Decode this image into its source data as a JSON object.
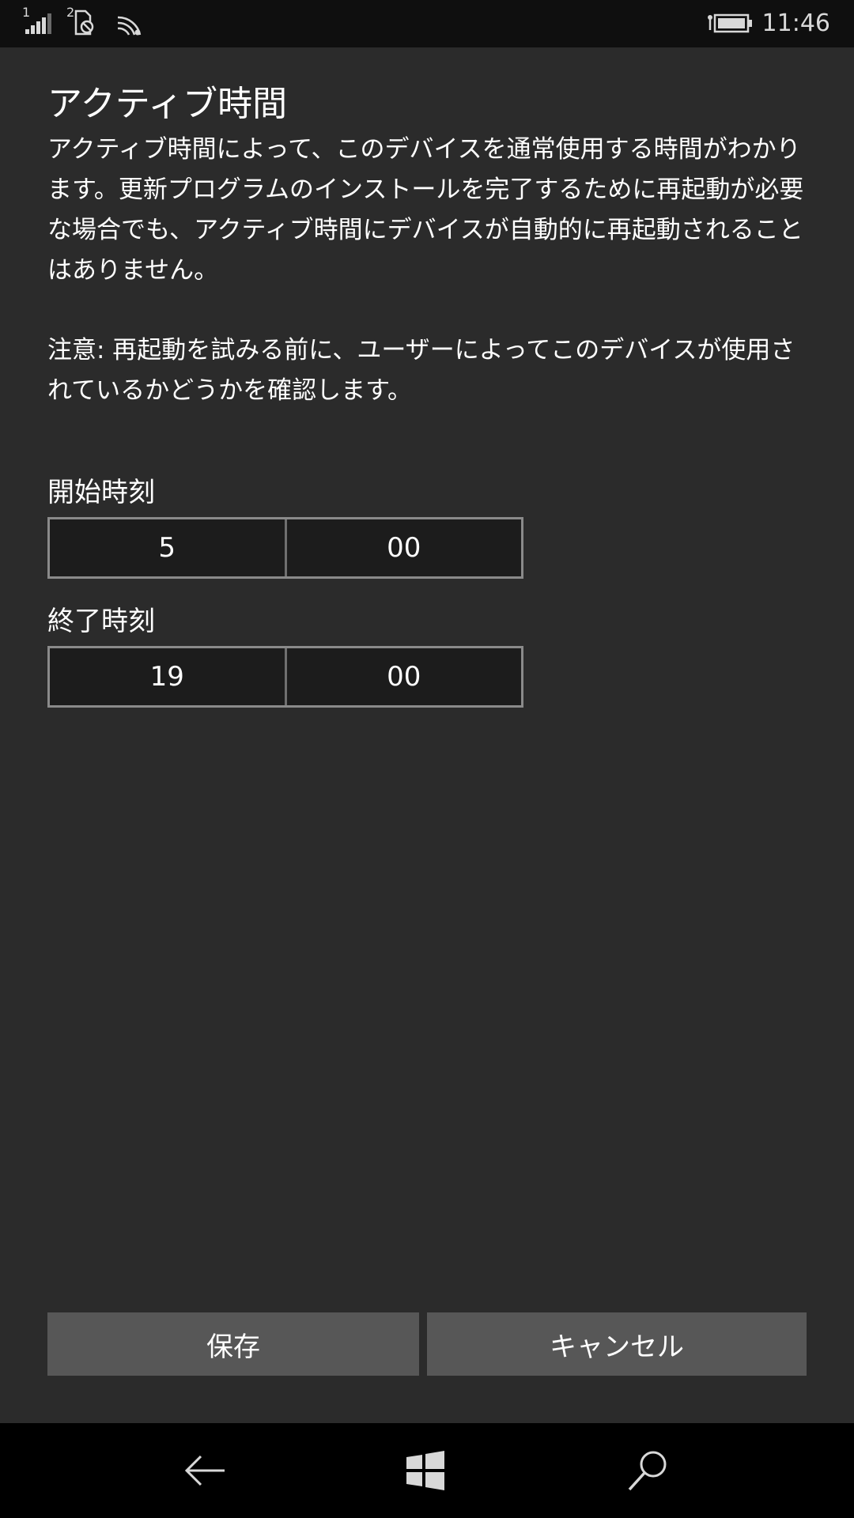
{
  "status_bar": {
    "sim1_label": "1",
    "sim2_label": "2",
    "time": "11:46"
  },
  "page": {
    "title": "アクティブ時間",
    "description": "アクティブ時間によって、このデバイスを通常使用する時間がわかります。更新プログラムのインストールを完了するために再起動が必要な場合でも、アクティブ時間にデバイスが自動的に再起動されることはありません。",
    "note": "注意: 再起動を試みる前に、ユーザーによってこのデバイスが使用されているかどうかを確認します。"
  },
  "start_time": {
    "label": "開始時刻",
    "hour": "5",
    "minute": "00"
  },
  "end_time": {
    "label": "終了時刻",
    "hour": "19",
    "minute": "00"
  },
  "buttons": {
    "save_label": "保存",
    "cancel_label": "キャンセル"
  },
  "nav": {
    "back_icon": "back-arrow-icon",
    "home_icon": "windows-logo-icon",
    "search_icon": "search-icon"
  },
  "colors": {
    "background": "#2b2b2b",
    "status_bar": "#0f0f0f",
    "nav_bar": "#000000",
    "button": "#575757",
    "picker_border": "#8a8a8a"
  }
}
